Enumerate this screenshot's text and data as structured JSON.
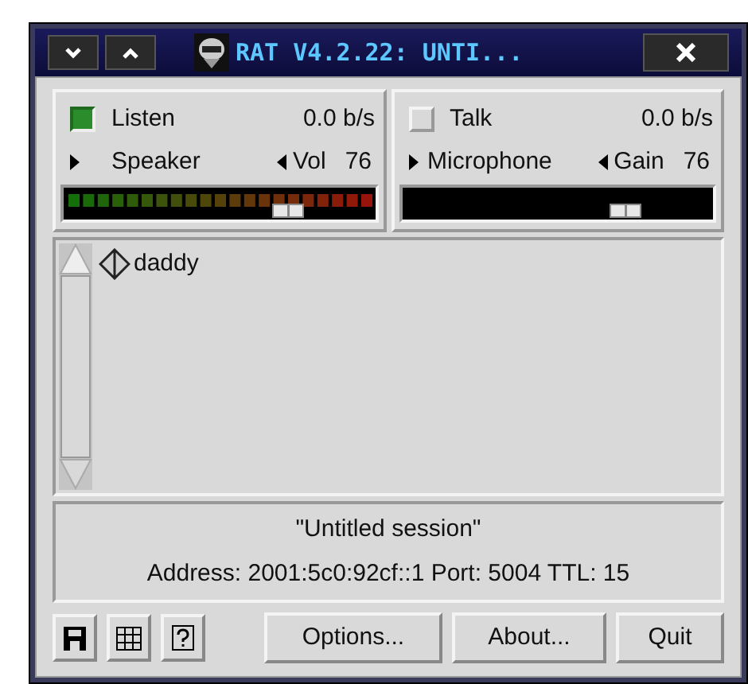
{
  "window": {
    "title": "RAT V4.2.22: UNTI..."
  },
  "channels": [
    {
      "label": "Listen",
      "checked": true,
      "rate": "0.0 b/s",
      "device": "Speaker",
      "control": "Vol",
      "value": "76",
      "level": 0.72
    },
    {
      "label": "Talk",
      "checked": false,
      "rate": "0.0 b/s",
      "device": "Microphone",
      "control": "Gain",
      "value": "76",
      "level": 0.72
    }
  ],
  "participants": [
    {
      "name": "daddy"
    }
  ],
  "session": {
    "title": "\"Untitled session\"",
    "details": "Address: 2001:5c0:92cf::1 Port: 5004 TTL: 15"
  },
  "buttons": [
    "Options...",
    "About...",
    "Quit"
  ]
}
